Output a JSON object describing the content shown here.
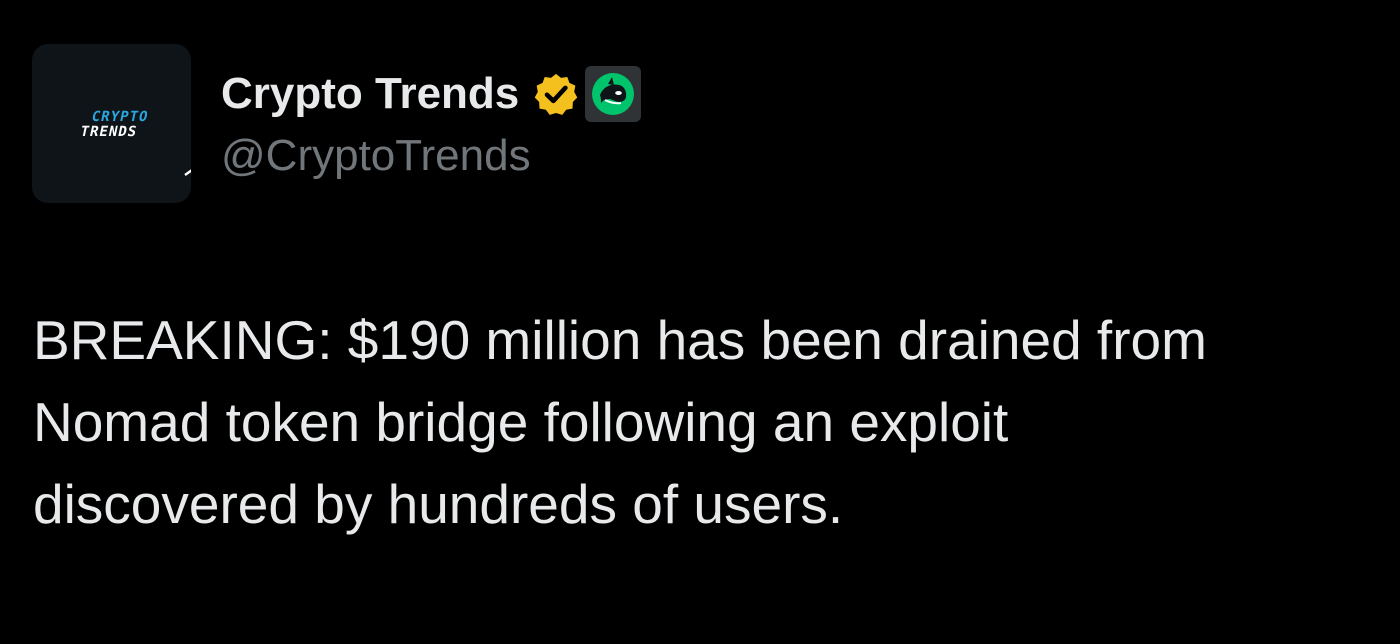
{
  "author": {
    "display_name": "Crypto Trends",
    "handle": "@CryptoTrends",
    "avatar_logo_line1": "CRYPTO",
    "avatar_logo_line2": "TRENDS",
    "verified_icon": "verified-badge-icon",
    "affiliate_icon": "orca-affiliate-icon",
    "verified_color": "#f4c01e",
    "affiliate_color": "#00c46c"
  },
  "tweet": {
    "lines": [
      "BREAKING: $190 million has been drained from",
      "Nomad token bridge following an exploit",
      "discovered by hundreds of users."
    ]
  },
  "colors": {
    "background": "#000000",
    "text_primary": "#e7e9ea",
    "text_secondary": "#71767b",
    "logo_accent": "#29a8e0"
  }
}
